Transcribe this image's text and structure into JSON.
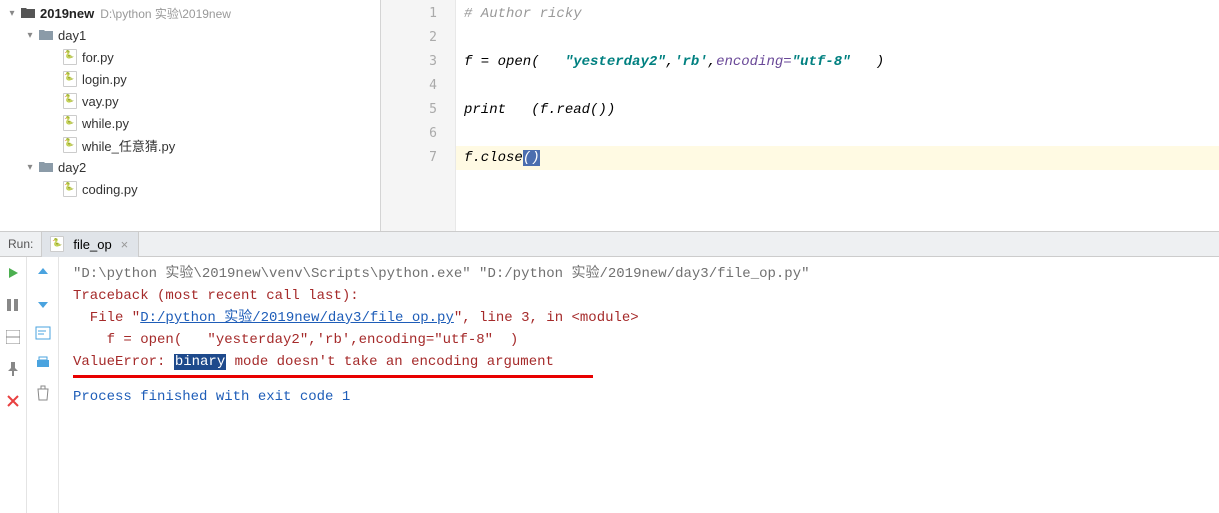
{
  "sidebar": {
    "root": {
      "name": "2019new",
      "path": "D:\\python 实验\\2019new"
    },
    "folders": [
      {
        "name": "day1",
        "expanded": true,
        "files": [
          "for.py",
          "login.py",
          "vay.py",
          "while.py",
          "while_任意猜.py"
        ]
      },
      {
        "name": "day2",
        "expanded": true,
        "files": [
          "coding.py"
        ]
      }
    ]
  },
  "editor": {
    "line_numbers": [
      "1",
      "2",
      "3",
      "4",
      "5",
      "6",
      "7"
    ],
    "code": {
      "l1_comment": "# Author ricky",
      "l3_a": "f = open(   ",
      "l3_str1": "\"yesterday2\"",
      "l3_mid": ",",
      "l3_str2": "'rb'",
      "l3_mid2": ",",
      "l3_kw": "encoding=",
      "l3_str3": "\"utf-8\"",
      "l3_end": "   )",
      "l5_a": "print   (f.read())",
      "l7_a": "f.close",
      "l7_sel": "()"
    }
  },
  "run": {
    "label": "Run:",
    "tab": "file_op",
    "console": {
      "cmd": "\"D:\\python 实验\\2019new\\venv\\Scripts\\python.exe\" \"D:/python 实验/2019new/day3/file_op.py\"",
      "tb1": "Traceback (most recent call last):",
      "tb2_a": "  File \"",
      "tb2_link": "D:/python 实验/2019new/day3/file op.py",
      "tb2_b": "\", line 3, in <module>",
      "tb3": "    f = open(   \"yesterday2\",'rb',encoding=\"utf-8\"  )",
      "err_a": "ValueError: ",
      "err_hl": "binary",
      "err_b": " mode doesn't take an encoding argument",
      "exit": "Process finished with exit code 1"
    }
  }
}
